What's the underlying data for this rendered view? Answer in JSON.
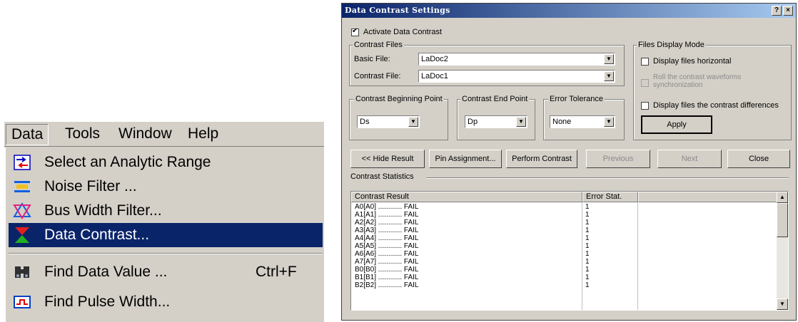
{
  "menu": {
    "menubar": [
      "Data",
      "Tools",
      "Window",
      "Help"
    ],
    "items": [
      {
        "label": "Select an Analytic Range",
        "icon": "analytic-range-icon",
        "shortcut": ""
      },
      {
        "label": "Noise Filter ...",
        "icon": "noise-filter-icon",
        "shortcut": ""
      },
      {
        "label": "Bus Width Filter...",
        "icon": "bus-width-filter-icon",
        "shortcut": ""
      },
      {
        "label": "Data Contrast...",
        "icon": "data-contrast-icon",
        "shortcut": "",
        "selected": true
      },
      {
        "label": "Find Data Value ...",
        "icon": "binoculars-icon",
        "shortcut": "Ctrl+F"
      },
      {
        "label": "Find Pulse Width...",
        "icon": "pulse-width-icon",
        "shortcut": ""
      }
    ],
    "colors": {
      "highlight": "#0a246a",
      "face": "#d4d0c8"
    }
  },
  "dialog": {
    "title": "Data Contrast Settings",
    "help_btn": "?",
    "close_btn": "×",
    "activate_label": "Activate Data Contrast",
    "contrast_files": {
      "legend": "Contrast Files",
      "basic_label": "Basic File:",
      "basic_value": "LaDoc2",
      "contrast_label": "Contrast File:",
      "contrast_value": "LaDoc1"
    },
    "display_mode": {
      "legend": "Files Display Mode",
      "opt1": "Display files horizontal",
      "opt2": "Roll the contrast waveforms synchronization",
      "opt3": "Display files the contrast differences",
      "apply": "Apply"
    },
    "begin": {
      "legend": "Contrast Beginning Point",
      "value": "Ds"
    },
    "end": {
      "legend": "Contrast End Point",
      "value": "Dp"
    },
    "tolerance": {
      "legend": "Error Tolerance",
      "value": "None"
    },
    "buttons": {
      "hide": "<< Hide Result",
      "pin": "Pin Assignment...",
      "perform": "Perform Contrast",
      "previous": "Previous",
      "next": "Next",
      "close": "Close"
    },
    "stats_label": "Contrast  Statistics",
    "table": {
      "headers": [
        "Contrast Result",
        "Error Stat."
      ],
      "rows": [
        [
          "A0[A0] ............ FAIL",
          "1"
        ],
        [
          "A1[A1] ............ FAIL",
          "1"
        ],
        [
          "A2[A2] ............ FAIL",
          "1"
        ],
        [
          "A3[A3] ............ FAIL",
          "1"
        ],
        [
          "A4[A4] ............ FAIL",
          "1"
        ],
        [
          "A5[A5] ............ FAIL",
          "1"
        ],
        [
          "A6[A6] ............ FAIL",
          "1"
        ],
        [
          "A7[A7] ............ FAIL",
          "1"
        ],
        [
          "B0[B0] ............ FAIL",
          "1"
        ],
        [
          "B1[B1] ............ FAIL",
          "1"
        ],
        [
          "B2[B2] ............ FAIL",
          "1"
        ]
      ]
    }
  }
}
